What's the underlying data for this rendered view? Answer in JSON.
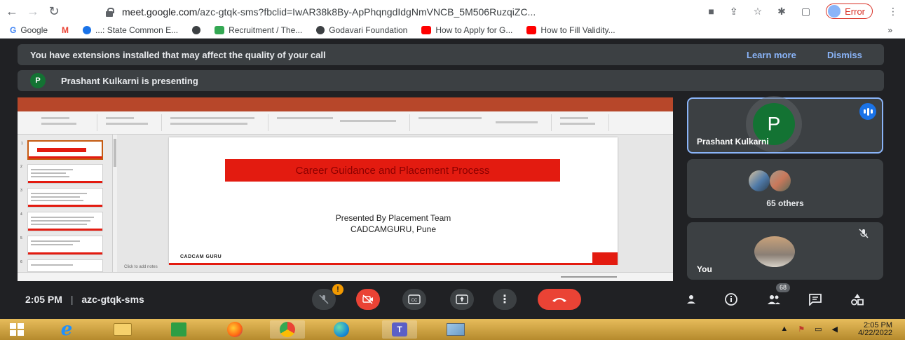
{
  "browser": {
    "url_host": "meet.google.com",
    "url_path": "/azc-gtqk-sms?fbclid=IwAR38k8By-ApPhqngdIdgNmVNCB_5M506RuzqiZC...",
    "profile_label": "Error",
    "bookmarks": [
      {
        "label": "Google",
        "color": "#4285f4"
      },
      {
        "label": "",
        "color": "#ea4335"
      },
      {
        "label": "...: State Common E...",
        "color": "#1a73e8"
      },
      {
        "label": "",
        "color": "#3c4043"
      },
      {
        "label": "Recruitment / The...",
        "color": "#34a853"
      },
      {
        "label": "Godavari Foundation",
        "color": "#3c4043"
      },
      {
        "label": "How to Apply for G...",
        "color": "#ff0000"
      },
      {
        "label": "How to Fill Validity...",
        "color": "#ff0000"
      }
    ],
    "more_bookmarks": "»"
  },
  "banner": {
    "message": "You have extensions installed that may affect the quality of your call",
    "learn_more": "Learn more",
    "dismiss": "Dismiss"
  },
  "presenting": {
    "avatar_letter": "P",
    "text": "Prashant Kulkarni is presenting"
  },
  "slide": {
    "title": "Career Guidance and Placement Process",
    "line1": "Presented By Placement Team",
    "line2": "CADCAMGURU, Pune",
    "logo": "CADCAM GURU",
    "notes": "Click to add notes"
  },
  "thumbs": [
    "1",
    "2",
    "3",
    "4",
    "5",
    "6"
  ],
  "tiles": {
    "presenter_letter": "P",
    "presenter_name": "Prashant Kulkarni",
    "others": "65 others",
    "you": "You"
  },
  "controls": {
    "time": "2:05 PM",
    "separator": "|",
    "meeting_code": "azc-gtqk-sms",
    "warning": "!",
    "participant_count": "68"
  },
  "taskbar": {
    "time": "2:05 PM",
    "date": "4/22/2022"
  }
}
